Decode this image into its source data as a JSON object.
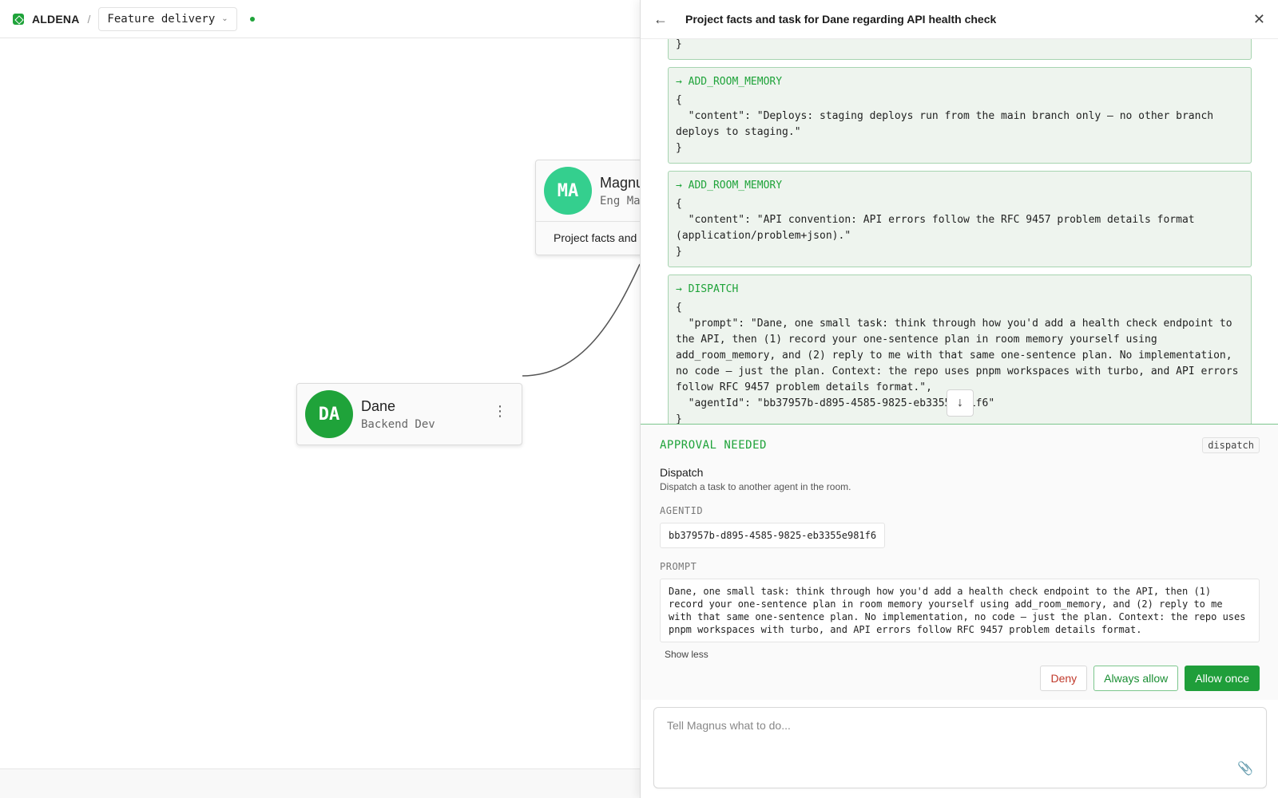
{
  "app": {
    "brand": "ALDENA",
    "separator": "/",
    "project": "Feature delivery",
    "accent": "#1fa33a"
  },
  "canvas": {
    "nodes": [
      {
        "initials": "DA",
        "name": "Dane",
        "role": "Backend Dev",
        "color": "#1fa33a"
      },
      {
        "initials": "MA",
        "name": "Magnus",
        "role": "Eng Manager",
        "color": "#34cf8e",
        "task": "Project facts and task for Dane regarding API health check"
      }
    ]
  },
  "panel": {
    "title": "Project facts and task for Dane regarding API health check",
    "events": [
      {
        "tool": "ADD_ROOM_MEMORY",
        "code": "{\n  \"content\": \"Deploys: staging deploys run from the main branch only — no other branch deploys to staging.\"\n}"
      },
      {
        "tool": "ADD_ROOM_MEMORY",
        "code": "{\n  \"content\": \"API convention: API errors follow the RFC 9457 problem details format (application/problem+json).\"\n}"
      },
      {
        "tool": "DISPATCH",
        "code": "{\n  \"prompt\": \"Dane, one small task: think through how you'd add a health check endpoint to the API, then (1) record your one-sentence plan in room memory yourself using add_room_memory, and (2) reply to me with that same one-sentence plan. No implementation, no code — just the plan. Context: the repo uses pnpm workspaces with turbo, and API errors follow RFC 9457 problem details format.\",\n  \"agentId\": \"bb37957b-d895-4585-9825-eb3355e981f6\"\n}"
      }
    ],
    "approval": {
      "heading": "APPROVAL NEEDED",
      "badge": "dispatch",
      "tool_name": "Dispatch",
      "tool_desc": "Dispatch a task to another agent in the room.",
      "agentid_label": "AGENTID",
      "agentid_value": "bb37957b-d895-4585-9825-eb3355e981f6",
      "prompt_label": "PROMPT",
      "prompt_value": "Dane, one small task: think through how you'd add a health check endpoint to the API, then (1) record your one-sentence plan in room memory yourself using add_room_memory, and (2) reply to me with that same one-sentence plan. No implementation, no code — just the plan. Context: the repo uses pnpm workspaces with turbo, and API errors follow RFC 9457 problem details format.",
      "show_less": "Show less",
      "deny": "Deny",
      "always_allow": "Always allow",
      "allow_once": "Allow once"
    },
    "composer_placeholder": "Tell Magnus what to do..."
  }
}
